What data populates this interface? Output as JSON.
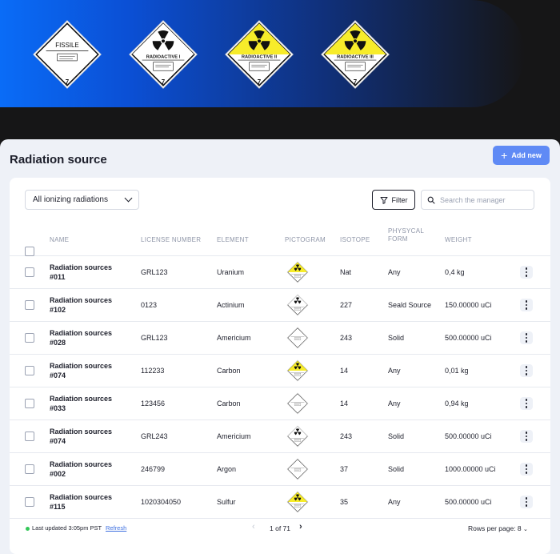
{
  "hero": {
    "labels": [
      {
        "name": "fissile",
        "text": "FISSILE",
        "number": "7",
        "color": "#ffffff"
      },
      {
        "name": "radioactive-i",
        "text": "RADIOACTIVE I",
        "number": "7",
        "color": "#ffffff"
      },
      {
        "name": "radioactive-ii",
        "text": "RADIOACTIVE II",
        "number": "7",
        "color": "#f7ec2a"
      },
      {
        "name": "radioactive-iii",
        "text": "RADIOACTIVE III",
        "number": "7",
        "color": "#f7ec2a"
      }
    ]
  },
  "page": {
    "title": "Radiation source",
    "add_button_label": "Add new",
    "add_button_icon": "plus-icon"
  },
  "toolbar": {
    "filter_select_value": "All ionizing radiations",
    "filter_button_label": "Filter",
    "search_placeholder": "Search the manager"
  },
  "table": {
    "headers": {
      "name": "NAME",
      "license": "LICENSE NUMBER",
      "element": "ELEMENT",
      "pictogram": "PICTOGRAM",
      "isotope": "ISOTOPE",
      "form": "PHYSYCAL FORM",
      "weight": "WEIGHT"
    },
    "rows": [
      {
        "name": "Radiation sources #011",
        "license": "GRL123",
        "element": "Uranium",
        "pictogram": "radioactive-yellow-icon",
        "isotope": "Nat",
        "form": "Any",
        "weight": "0,4 kg"
      },
      {
        "name": "Radiation sources #102",
        "license": "0123",
        "element": "Actinium",
        "pictogram": "radioactive-white-icon",
        "isotope": "227",
        "form": "Seald Source",
        "weight": "150.00000 uCi"
      },
      {
        "name": "Radiation sources #028",
        "license": "GRL123",
        "element": "Americium",
        "pictogram": "fissile-icon",
        "isotope": "243",
        "form": "Solid",
        "weight": "500.00000 uCi"
      },
      {
        "name": "Radiation sources #074",
        "license": "112233",
        "element": "Carbon",
        "pictogram": "radioactive-yellow-icon",
        "isotope": "14",
        "form": "Any",
        "weight": "0,01 kg"
      },
      {
        "name": "Radiation sources #033",
        "license": "123456",
        "element": "Carbon",
        "pictogram": "fissile-icon",
        "isotope": "14",
        "form": "Any",
        "weight": "0,94 kg"
      },
      {
        "name": "Radiation sources #074",
        "license": "GRL243",
        "element": "Americium",
        "pictogram": "radioactive-white-icon",
        "isotope": "243",
        "form": "Solid",
        "weight": "500.00000 uCi"
      },
      {
        "name": "Radiation sources #002",
        "license": "246799",
        "element": "Argon",
        "pictogram": "fissile-icon",
        "isotope": "37",
        "form": "Solid",
        "weight": "1000.00000 uCi"
      },
      {
        "name": "Radiation sources #115",
        "license": "1020304050",
        "element": "Sulfur",
        "pictogram": "radioactive-yellow-icon",
        "isotope": "35",
        "form": "Any",
        "weight": "500.00000 uCi"
      }
    ]
  },
  "footer": {
    "last_updated": "Last updated 3:05pm PST",
    "refresh_label": "Refresh",
    "pagination": "1 of 71",
    "rows_per_page": "Rows per page: 8"
  },
  "colors": {
    "accent": "#5f8af5",
    "hazard_yellow": "#f7ec2a",
    "status_green": "#34c759"
  }
}
